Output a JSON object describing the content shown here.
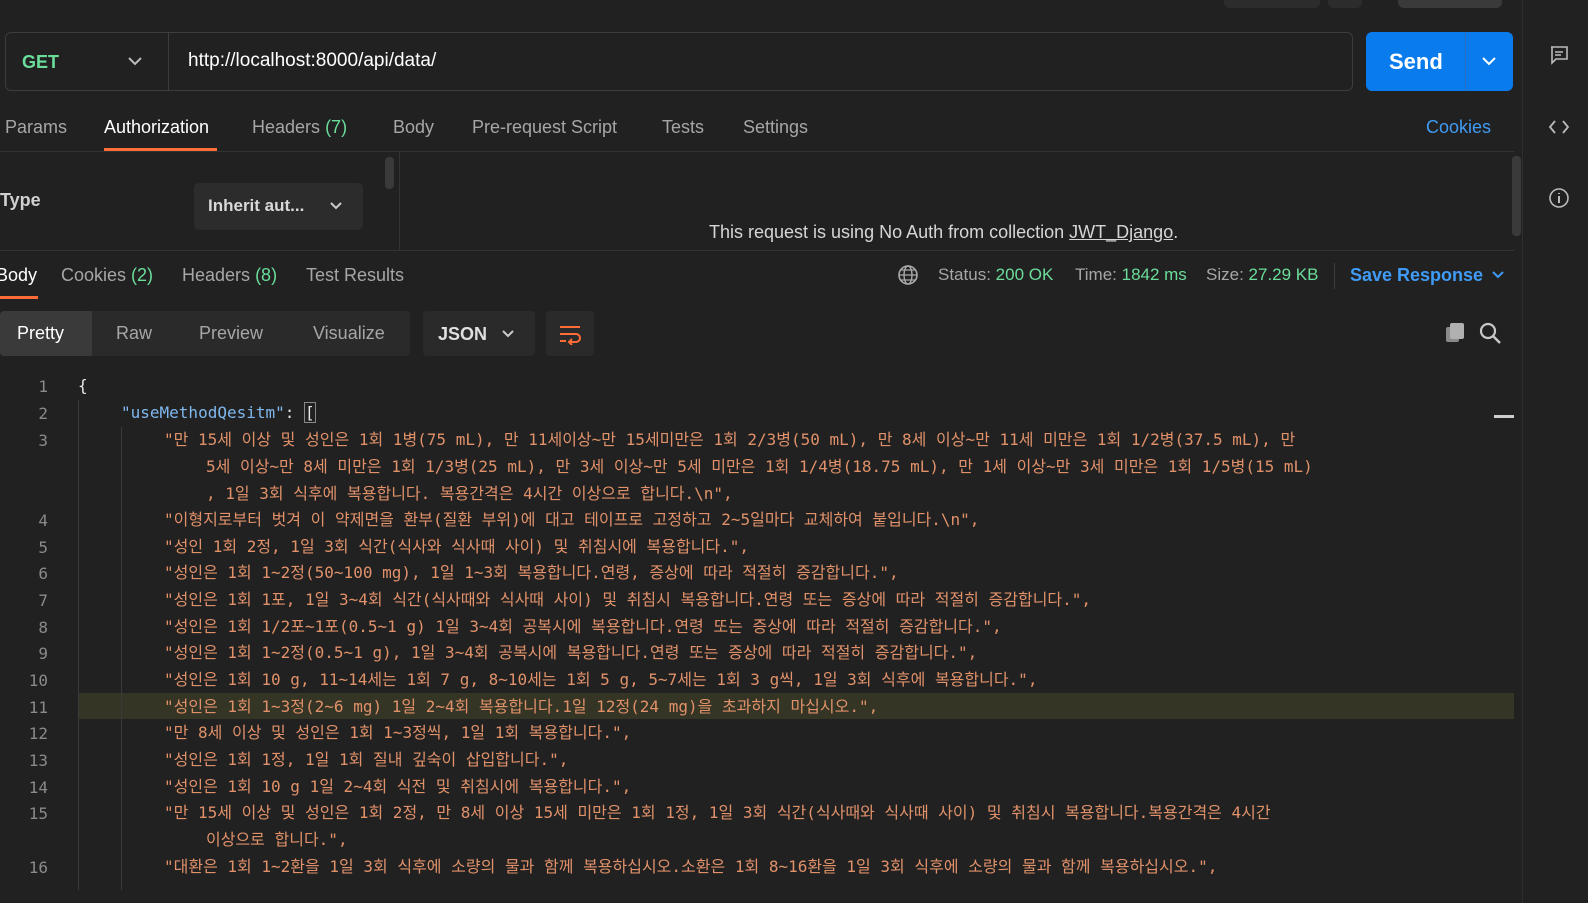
{
  "request": {
    "method": "GET",
    "url": "http://localhost:8000/api/data/",
    "send_label": "Send"
  },
  "request_tabs": [
    {
      "label": "Params"
    },
    {
      "label": "Authorization"
    },
    {
      "label": "Headers",
      "count": "(7)"
    },
    {
      "label": "Body"
    },
    {
      "label": "Pre-request Script"
    },
    {
      "label": "Tests"
    },
    {
      "label": "Settings"
    }
  ],
  "cookies_link": "Cookies",
  "auth": {
    "type_label": "Type",
    "type_value": "Inherit aut...",
    "message_prefix": "This request is using No Auth from collection ",
    "collection": "JWT_Django",
    "message_suffix": "."
  },
  "response_tabs": [
    {
      "label": "Body"
    },
    {
      "label": "Cookies",
      "count": "(2)"
    },
    {
      "label": "Headers",
      "count": "(8)"
    },
    {
      "label": "Test Results"
    }
  ],
  "response_meta": {
    "status_label": "Status:",
    "status_value": "200 OK",
    "time_label": "Time:",
    "time_value": "1842 ms",
    "size_label": "Size:",
    "size_value": "27.29 KB",
    "save_label": "Save Response"
  },
  "view_modes": [
    "Pretty",
    "Raw",
    "Preview",
    "Visualize"
  ],
  "format": "JSON",
  "colors": {
    "accent": "#ff6c37",
    "send": "#097bed",
    "green": "#6bdd9a",
    "link": "#3f9bf5",
    "string": "#e0916a",
    "key": "#7fb8ee"
  },
  "code": {
    "line_numbers": [
      "1",
      "2",
      "3",
      "4",
      "5",
      "6",
      "7",
      "8",
      "9",
      "10",
      "11",
      "12",
      "13",
      "14",
      "15",
      "16"
    ],
    "open_brace": "{",
    "key": "\"useMethodQesitm\"",
    "key_sep": ": ",
    "open_bracket": "[",
    "l3a": "\"만 15세 이상 및 성인은 1회 1병(75 mL), 만 11세이상~만 15세미만은 1회 2/3병(50 mL), 만 8세 이상~만 11세 미만은 1회 1/2병(37.5 mL), 만",
    "l3b": "5세 이상~만 8세 미만은 1회 1/3병(25 mL), 만 3세 이상~만 5세 미만은 1회 1/4병(18.75 mL), 만 1세 이상~만 3세 미만은 1회 1/5병(15 mL)",
    "l3c": ", 1일 3회 식후에 복용합니다. 복용간격은 4시간 이상으로 합니다.\\n\",",
    "l4": "\"이형지로부터 벗겨 이 약제면을 환부(질환 부위)에 대고 테이프로 고정하고 2~5일마다 교체하여 붙입니다.\\n\",",
    "l5": "\"성인 1회 2정, 1일 3회 식간(식사와 식사때 사이) 및 취침시에 복용합니다.\",",
    "l6": "\"성인은 1회 1~2정(50~100 mg), 1일 1~3회 복용합니다.연령, 증상에 따라 적절히 증감합니다.\",",
    "l7": "\"성인은 1회 1포, 1일 3~4회 식간(식사때와 식사때 사이) 및 취침시 복용합니다.연령 또는 증상에 따라 적절히 증감합니다.\",",
    "l8": "\"성인은 1회 1/2포~1포(0.5~1 g) 1일 3~4회 공복시에 복용합니다.연령 또는 증상에 따라 적절히 증감합니다.\",",
    "l9": "\"성인은 1회 1~2정(0.5~1 g), 1일 3~4회 공복시에 복용합니다.연령 또는 증상에 따라 적절히 증감합니다.\",",
    "l10": "\"성인은 1회 10 g, 11~14세는 1회 7 g, 8~10세는 1회 5 g, 5~7세는 1회 3 g씩, 1일 3회 식후에 복용합니다.\",",
    "l11": "\"성인은 1회 1~3정(2~6 mg) 1일 2~4회 복용합니다.1일 12정(24 mg)을 초과하지 마십시오.\",",
    "l12": "\"만 8세 이상 및 성인은 1회 1~3정씩, 1일 1회 복용합니다.\",",
    "l13": "\"성인은 1회 1정, 1일 1회 질내 깊숙이 삽입합니다.\",",
    "l14": "\"성인은 1회 10 g 1일 2~4회 식전 및 취침시에 복용합니다.\",",
    "l15a": "\"만 15세 이상 및 성인은 1회 2정, 만 8세 이상 15세 미만은 1회 1정, 1일 3회 식간(식사때와 식사때 사이) 및 취침시 복용합니다.복용간격은 4시간",
    "l15b": "이상으로 합니다.\",",
    "l16": "\"대환은 1회 1~2환을 1일 3회 식후에 소량의 물과 함께 복용하십시오.소환은 1회 8~16환을 1일 3회 식후에 소량의 물과 함께 복용하십시오.\","
  }
}
